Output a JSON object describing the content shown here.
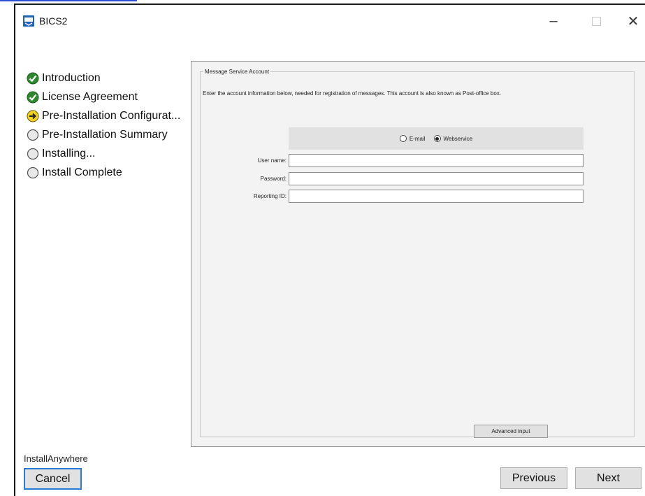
{
  "window": {
    "title": "BICS2",
    "controls": {
      "minimize": "–",
      "close": "✕"
    }
  },
  "steps": [
    {
      "label": "Introduction",
      "status": "done",
      "icon": "check-icon"
    },
    {
      "label": "License Agreement",
      "status": "done",
      "icon": "check-icon"
    },
    {
      "label": "Pre-Installation Configurat...",
      "status": "current",
      "icon": "arrow-icon"
    },
    {
      "label": "Pre-Installation Summary",
      "status": "pending",
      "icon": "empty-circle-icon"
    },
    {
      "label": "Installing...",
      "status": "pending",
      "icon": "empty-circle-icon"
    },
    {
      "label": "Install Complete",
      "status": "pending",
      "icon": "empty-circle-icon"
    }
  ],
  "panel": {
    "legend": "Message Service Account",
    "intro": "Enter the account information below, needed for registration of messages. This account is also known as Post-office box.",
    "radio": {
      "options": [
        "E-mail",
        "Webservice"
      ],
      "selected": "Webservice"
    },
    "fields": [
      {
        "label": "User name:",
        "value": ""
      },
      {
        "label": "Password:",
        "value": ""
      },
      {
        "label": "Reporting ID:",
        "value": ""
      }
    ],
    "advanced_label": "Advanced input"
  },
  "footer": {
    "brand": "InstallAnywhere",
    "cancel_label": "Cancel",
    "previous_label": "Previous",
    "next_label": "Next"
  },
  "colors": {
    "done_green": "#2f8a2f",
    "current_yellow": "#f2d21a",
    "focus_blue": "#2b7bd6"
  }
}
